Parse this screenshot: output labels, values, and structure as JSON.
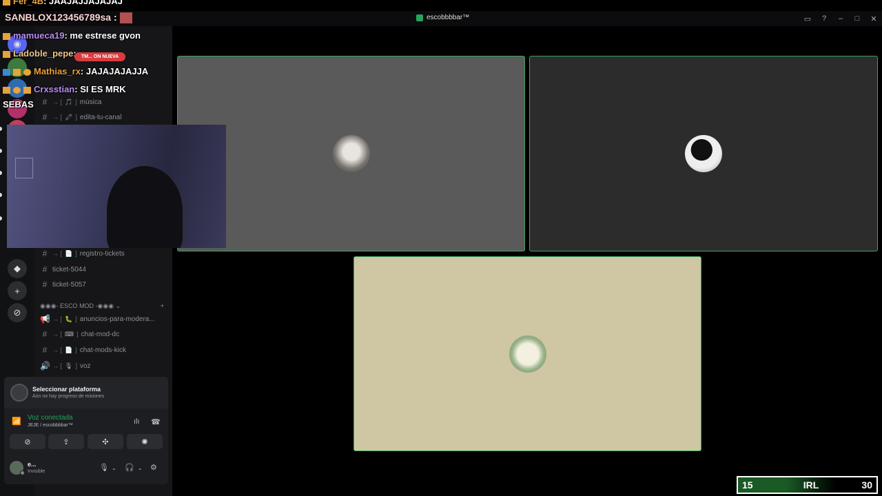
{
  "window": {
    "title": "escobbbbar™"
  },
  "channels": [
    {
      "emoji": "🎵",
      "name": "música"
    },
    {
      "emoji": "🖍",
      "name": "edita-tu-canal"
    },
    {
      "emoji": "📄",
      "name": "registro-tickets"
    }
  ],
  "tickets": [
    "ticket-5044",
    "ticket-5057"
  ],
  "category": {
    "name": "◉◉◉- ESCO MOD -◉◉◉ ⌄",
    "add": "+"
  },
  "mod_channels": [
    {
      "icon": "📢",
      "emoji": "🐛",
      "name": "anuncios-para-modera..."
    },
    {
      "icon": "#",
      "emoji": "⌨",
      "name": "chat-mod-dc"
    },
    {
      "icon": "#",
      "emoji": "📄",
      "name": "chat-mods-kick"
    },
    {
      "icon": "🔊",
      "emoji": "🎙",
      "name": "voz"
    }
  ],
  "quest": {
    "title": "Seleccionar plataforma",
    "subtitle": "Aún no hay progreso de misiones"
  },
  "voice": {
    "status": "Voz conectada",
    "channel": "JEJE / escobbbbar™"
  },
  "user": {
    "name": "e...",
    "status": "Invisible"
  },
  "chat": [
    {
      "user": "Fer_4B",
      "text": ": JAAJAJJAJAJAJ",
      "color": "#e6a23c"
    },
    {
      "user": "SANBLOX123456789sa",
      "text": " : ",
      "color": "#ffffff"
    },
    {
      "user": "mamueca19",
      "text": ": me estrese gvon",
      "color": "#b98cf5"
    },
    {
      "user": "Ladoble_pepe",
      "text": ":",
      "color": "#f0c68a"
    },
    {
      "user": "Mathias_rx",
      "text": ": JAJAJAJAJJA",
      "color": "#e6a23c"
    },
    {
      "user": "Crxsstian",
      "text": ": SI ES MRK",
      "color": "#b98cf5"
    },
    {
      "user": "SEBAS",
      "text": "",
      "color": "#ffffff"
    }
  ],
  "new_badge": "TM... ON NUEVA",
  "score": {
    "left": "15",
    "mid": "IRL",
    "right": "30"
  },
  "colors": {
    "accent": "#23a55a",
    "tile_border": "#3ba55c",
    "tile1": "#5a5a5a",
    "tile2": "#2c2c2c",
    "tile3": "#cfc6a4"
  }
}
